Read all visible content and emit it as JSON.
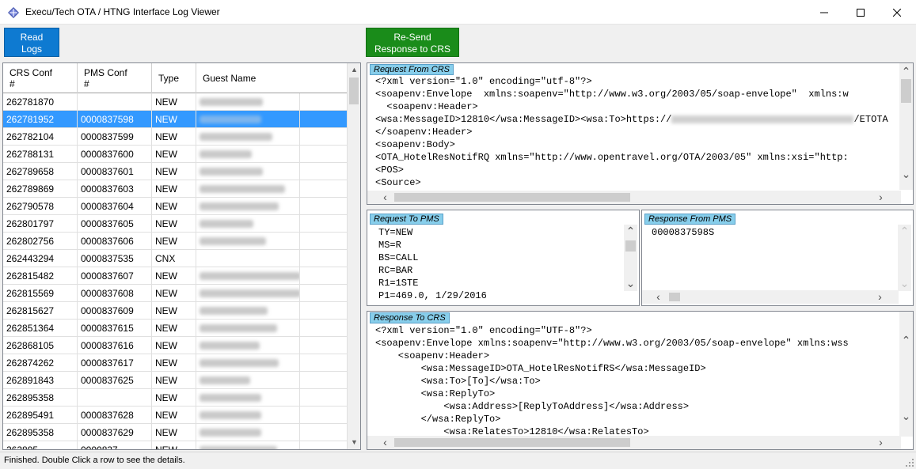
{
  "window": {
    "title": "Execu/Tech OTA / HTNG Interface Log Viewer",
    "icon": "app-diamond-icon",
    "controls": [
      "minimize-icon",
      "maximize-icon",
      "close-icon"
    ]
  },
  "toolbar": {
    "read_logs_line1": "Read",
    "read_logs_line2": "Logs",
    "resend_line1": "Re-Send",
    "resend_line2": "Response to CRS",
    "read_color": "#0e7ad1",
    "resend_color": "#1a8c1a"
  },
  "grid": {
    "headers": {
      "crs_line1": "CRS Conf",
      "crs_line2": "#",
      "pms_line1": "PMS Conf",
      "pms_line2": "#",
      "type": "Type",
      "guest": "Guest Name"
    },
    "rows": [
      {
        "crs": "262781870",
        "pms": "",
        "type": "NEW",
        "name_w": 80
      },
      {
        "crs": "262781952",
        "pms": "0000837598",
        "type": "NEW",
        "name_w": 78,
        "selected": true
      },
      {
        "crs": "262782104",
        "pms": "0000837599",
        "type": "NEW",
        "name_w": 92
      },
      {
        "crs": "262788131",
        "pms": "0000837600",
        "type": "NEW",
        "name_w": 66
      },
      {
        "crs": "262789658",
        "pms": "0000837601",
        "type": "NEW",
        "name_w": 80
      },
      {
        "crs": "262789869",
        "pms": "0000837603",
        "type": "NEW",
        "name_w": 108
      },
      {
        "crs": "262790578",
        "pms": "0000837604",
        "type": "NEW",
        "name_w": 100
      },
      {
        "crs": "262801797",
        "pms": "0000837605",
        "type": "NEW",
        "name_w": 68
      },
      {
        "crs": "262802756",
        "pms": "0000837606",
        "type": "NEW",
        "name_w": 84
      },
      {
        "crs": "262443294",
        "pms": "0000837535",
        "type": "CNX",
        "name_w": 0
      },
      {
        "crs": "262815482",
        "pms": "0000837607",
        "type": "NEW",
        "name_w": 128
      },
      {
        "crs": "262815569",
        "pms": "0000837608",
        "type": "NEW",
        "name_w": 128
      },
      {
        "crs": "262815627",
        "pms": "0000837609",
        "type": "NEW",
        "name_w": 86
      },
      {
        "crs": "262851364",
        "pms": "0000837615",
        "type": "NEW",
        "name_w": 98
      },
      {
        "crs": "262868105",
        "pms": "0000837616",
        "type": "NEW",
        "name_w": 76
      },
      {
        "crs": "262874262",
        "pms": "0000837617",
        "type": "NEW",
        "name_w": 100
      },
      {
        "crs": "262891843",
        "pms": "0000837625",
        "type": "NEW",
        "name_w": 64
      },
      {
        "crs": "262895358",
        "pms": "",
        "type": "NEW",
        "name_w": 78
      },
      {
        "crs": "262895491",
        "pms": "0000837628",
        "type": "NEW",
        "name_w": 78
      },
      {
        "crs": "262895358",
        "pms": "0000837629",
        "type": "NEW",
        "name_w": 78
      },
      {
        "crs": "262895...",
        "pms": "0000837...",
        "type": "NEW",
        "name_w": 98
      }
    ]
  },
  "request_from_crs": {
    "label": "Request From CRS",
    "lines": [
      "<?xml version=\"1.0\" encoding=\"utf-8\"?>",
      "<soapenv:Envelope  xmlns:soapenv=\"http://www.w3.org/2003/05/soap-envelope\"  xmlns:w",
      "  <soapenv:Header>",
      "<wsa:MessageID>12810</wsa:MessageID><wsa:To>https://",
      "</soapenv:Header>",
      "<soapenv:Body>",
      "<OTA_HotelResNotifRQ xmlns=\"http://www.opentravel.org/OTA/2003/05\" xmlns:xsi=\"http:",
      "<POS>",
      "<Source>"
    ],
    "url_tail": "/ETOTA"
  },
  "request_to_pms": {
    "label": "Request To PMS",
    "lines": [
      "TY=NEW",
      "MS=R",
      "BS=CALL",
      "RC=BAR",
      "R1=1STE",
      "P1=469.0, 1/29/2016"
    ]
  },
  "response_from_pms": {
    "label": "Response From PMS",
    "lines": [
      "0000837598S"
    ]
  },
  "response_to_crs": {
    "label": "Response To CRS",
    "lines": [
      "<?xml version=\"1.0\" encoding=\"UTF-8\"?>",
      "<soapenv:Envelope xmlns:soapenv=\"http://www.w3.org/2003/05/soap-envelope\" xmlns:wss",
      "    <soapenv:Header>",
      "        <wsa:MessageID>OTA_HotelResNotifRS</wsa:MessageID>",
      "        <wsa:To>[To]</wsa:To>",
      "        <wsa:ReplyTo>",
      "            <wsa:Address>[ReplyToAddress]</wsa:Address>",
      "        </wsa:ReplyTo>",
      "            <wsa:RelatesTo>12810</wsa:RelatesTo>"
    ]
  },
  "status": {
    "text": "Finished. Double Click a row to see the details."
  }
}
